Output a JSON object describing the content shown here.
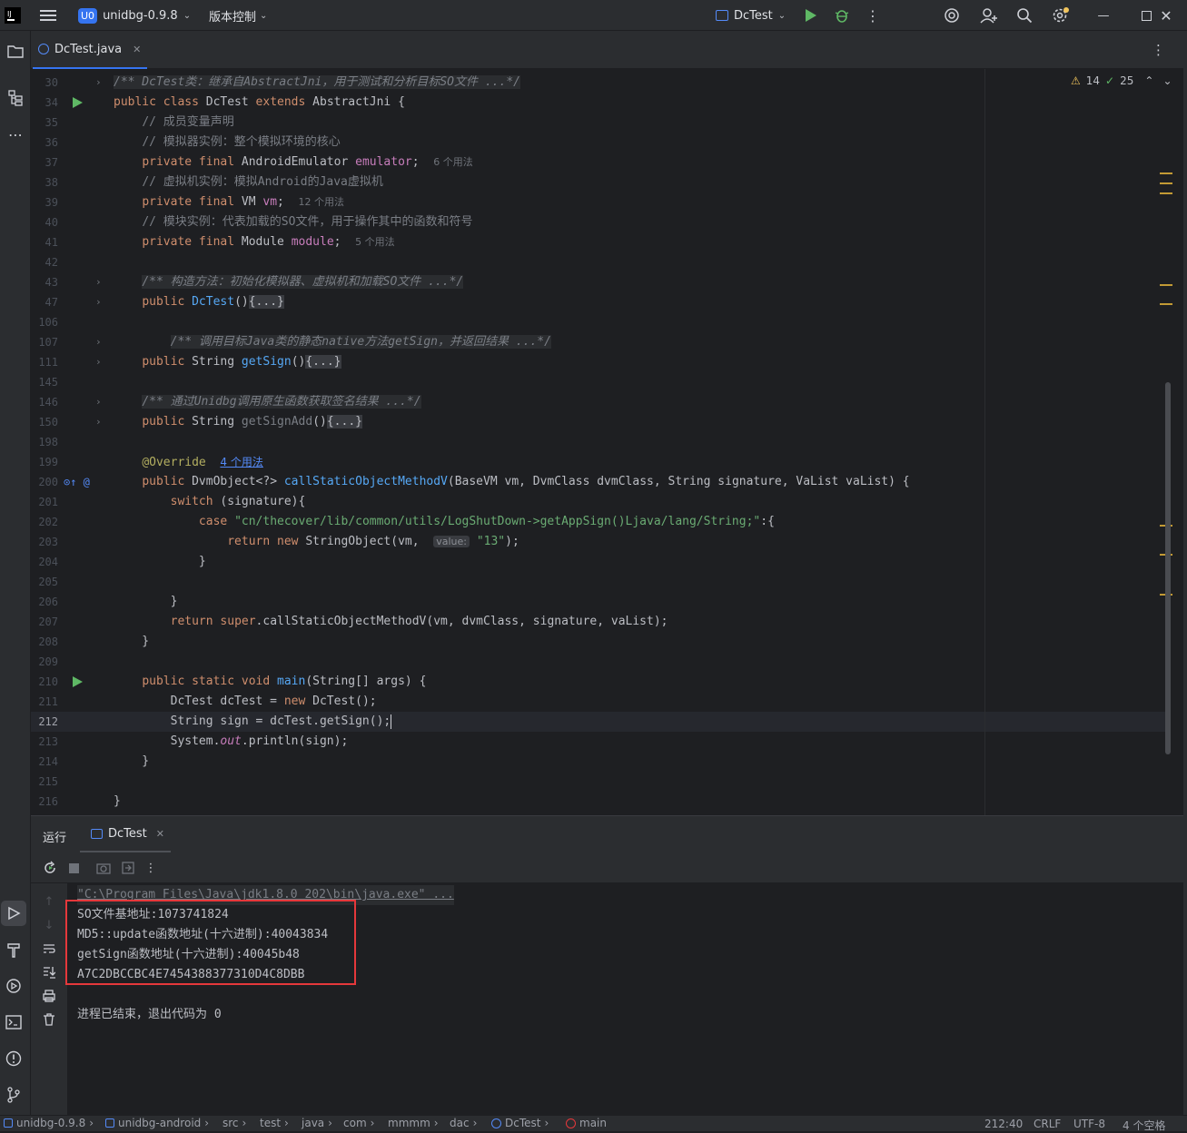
{
  "titlebar": {
    "project_badge": "U0",
    "project_name": "unidbg-0.9.8",
    "vcs_label": "版本控制",
    "run_config": "DcTest"
  },
  "editor_tab": {
    "label": "DcTest.java"
  },
  "inspections": {
    "warnings": "14",
    "ok": "25"
  },
  "code_lines": [
    {
      "n": "30",
      "html": "<span class=\"fdoc\">/** DcTest类：继承自AbstractJni，用于测试和分析目标SO文件 ...*/</span>"
    },
    {
      "n": "34",
      "html": "<span class=\"kw\">public class</span> DcTest <span class=\"kw\">extends</span> AbstractJni {"
    },
    {
      "n": "35",
      "html": "    <span class=\"cmt\">// 成员变量声明</span>"
    },
    {
      "n": "36",
      "html": "    <span class=\"cmt\">// 模拟器实例：整个模拟环境的核心</span>"
    },
    {
      "n": "37",
      "html": "    <span class=\"kw\">private final</span> AndroidEmulator <span class=\"fld\">emulator</span>;  <span class=\"hint\">6 个用法</span>"
    },
    {
      "n": "38",
      "html": "    <span class=\"cmt\">// 虚拟机实例：模拟Android的Java虚拟机</span>"
    },
    {
      "n": "39",
      "html": "    <span class=\"kw\">private final</span> VM <span class=\"fld\">vm</span>;  <span class=\"hint\">12 个用法</span>"
    },
    {
      "n": "40",
      "html": "    <span class=\"cmt\">// 模块实例：代表加载的SO文件，用于操作其中的函数和符号</span>"
    },
    {
      "n": "41",
      "html": "    <span class=\"kw\">private final</span> Module <span class=\"fld\">module</span>;  <span class=\"hint\">5 个用法</span>"
    },
    {
      "n": "42",
      "html": ""
    },
    {
      "n": "43",
      "html": "    <span class=\"fdoc\">/** 构造方法：初始化模拟器、虚拟机和加载SO文件 ...*/</span>"
    },
    {
      "n": "47",
      "html": "    <span class=\"kw\">public</span> <span class=\"fn\">DcTest</span>()<span class=\"fold-bg\">{...}</span>"
    },
    {
      "n": "106",
      "html": ""
    },
    {
      "n": "107",
      "html": "        <span class=\"fdoc\">/** 调用目标Java类的静态native方法getSign，并返回结果 ...*/</span>"
    },
    {
      "n": "111",
      "html": "    <span class=\"kw\">public</span> String <span class=\"fn\">getSign</span>()<span class=\"fold-bg\">{...}</span>"
    },
    {
      "n": "145",
      "html": ""
    },
    {
      "n": "146",
      "html": "    <span class=\"fdoc\">/** 通过Unidbg调用原生函数获取签名结果 ...*/</span>"
    },
    {
      "n": "150",
      "html": "    <span class=\"kw\">public</span> String <span class=\"cmt\">getSignAdd</span>()<span class=\"fold-bg\">{...}</span>"
    },
    {
      "n": "198",
      "html": ""
    },
    {
      "n": "199",
      "html": "    <span class=\"ann\">@Override</span>  <span class=\"usages\">4 个用法</span>"
    },
    {
      "n": "200",
      "html": "    <span class=\"kw\">public</span> DvmObject&lt;?&gt; <span class=\"fn\">callStaticObjectMethodV</span>(BaseVM vm, DvmClass dvmClass, String signature, VaList vaList) {"
    },
    {
      "n": "201",
      "html": "        <span class=\"kw\">switch</span> (signature){"
    },
    {
      "n": "202",
      "html": "            <span class=\"kw\">case</span> <span class=\"str\">\"cn/thecover/lib/common/utils/LogShutDown-&gt;getAppSign()Ljava/lang/String;\"</span>:{"
    },
    {
      "n": "203",
      "html": "                <span class=\"kw\">return new</span> StringObject(vm,  <span class=\"inlay\">value:</span> <span class=\"str\">\"13\"</span>);"
    },
    {
      "n": "204",
      "html": "            }"
    },
    {
      "n": "205",
      "html": ""
    },
    {
      "n": "206",
      "html": "        }"
    },
    {
      "n": "207",
      "html": "        <span class=\"kw\">return super</span>.callStaticObjectMethodV(vm, dvmClass, signature, vaList);"
    },
    {
      "n": "208",
      "html": "    }"
    },
    {
      "n": "209",
      "html": ""
    },
    {
      "n": "210",
      "html": "    <span class=\"kw\">public static void</span> <span class=\"fn\">main</span>(String[] args) {"
    },
    {
      "n": "211",
      "html": "        DcTest dcTest = <span class=\"kw\">new</span> DcTest();"
    },
    {
      "n": "212",
      "html": "        String sign = dcTest.getSign();"
    },
    {
      "n": "213",
      "html": "        System.<span class=\"fld\" style=\"font-style:italic\">out</span>.println(sign);"
    },
    {
      "n": "214",
      "html": "    }"
    },
    {
      "n": "215",
      "html": ""
    },
    {
      "n": "216",
      "html": "}"
    }
  ],
  "run_panel": {
    "title": "运行",
    "tab_label": "DcTest",
    "command": "\"C:\\Program Files\\Java\\jdk1.8.0_202\\bin\\java.exe\" ...",
    "output": [
      "SO文件基地址:1073741824",
      "MD5::update函数地址(十六进制):40043834",
      "getSign函数地址(十六进制):40045b48",
      "A7C2DBCCBC4E7454388377310D4C8DBB"
    ],
    "exit_message": "进程已结束，退出代码为 0"
  },
  "statusbar": {
    "crumbs": [
      "unidbg-0.9.8",
      "unidbg-android",
      "src",
      "test",
      "java",
      "com",
      "mmmm",
      "dac",
      "DcTest",
      "main"
    ],
    "position": "212:40",
    "line_ending": "CRLF",
    "encoding": "UTF-8",
    "indent": "4 个空格"
  },
  "colors": {
    "accent": "#3574f0",
    "highlight_box": "#e5383b",
    "run_green": "#5fb865"
  }
}
